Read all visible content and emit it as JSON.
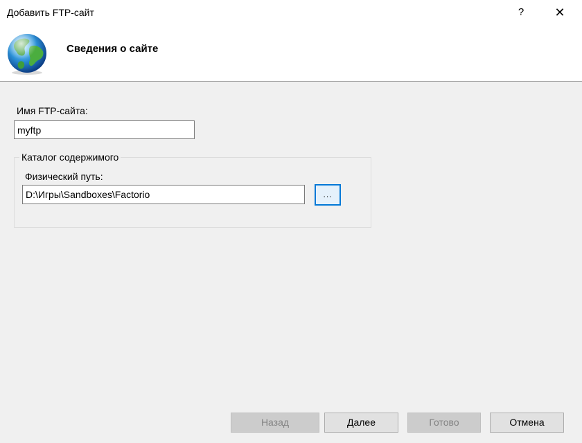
{
  "window": {
    "title": "Добавить FTP-сайт",
    "help_label": "?",
    "close_label": "✕"
  },
  "header": {
    "title": "Сведения о сайте",
    "icon": "globe-icon"
  },
  "form": {
    "site_name_label": "Имя FTP-сайта:",
    "site_name_value": "myftp",
    "content_group_label": "Каталог содержимого",
    "physical_path_label": "Физический путь:",
    "physical_path_value": "D:\\Игры\\Sandboxes\\Factorio",
    "browse_label": "..."
  },
  "footer": {
    "back_label": "Назад",
    "next_label": "Далее",
    "finish_label": "Готово",
    "cancel_label": "Отмена"
  },
  "colors": {
    "background": "#f0f0f0",
    "accent": "#0078d7"
  }
}
